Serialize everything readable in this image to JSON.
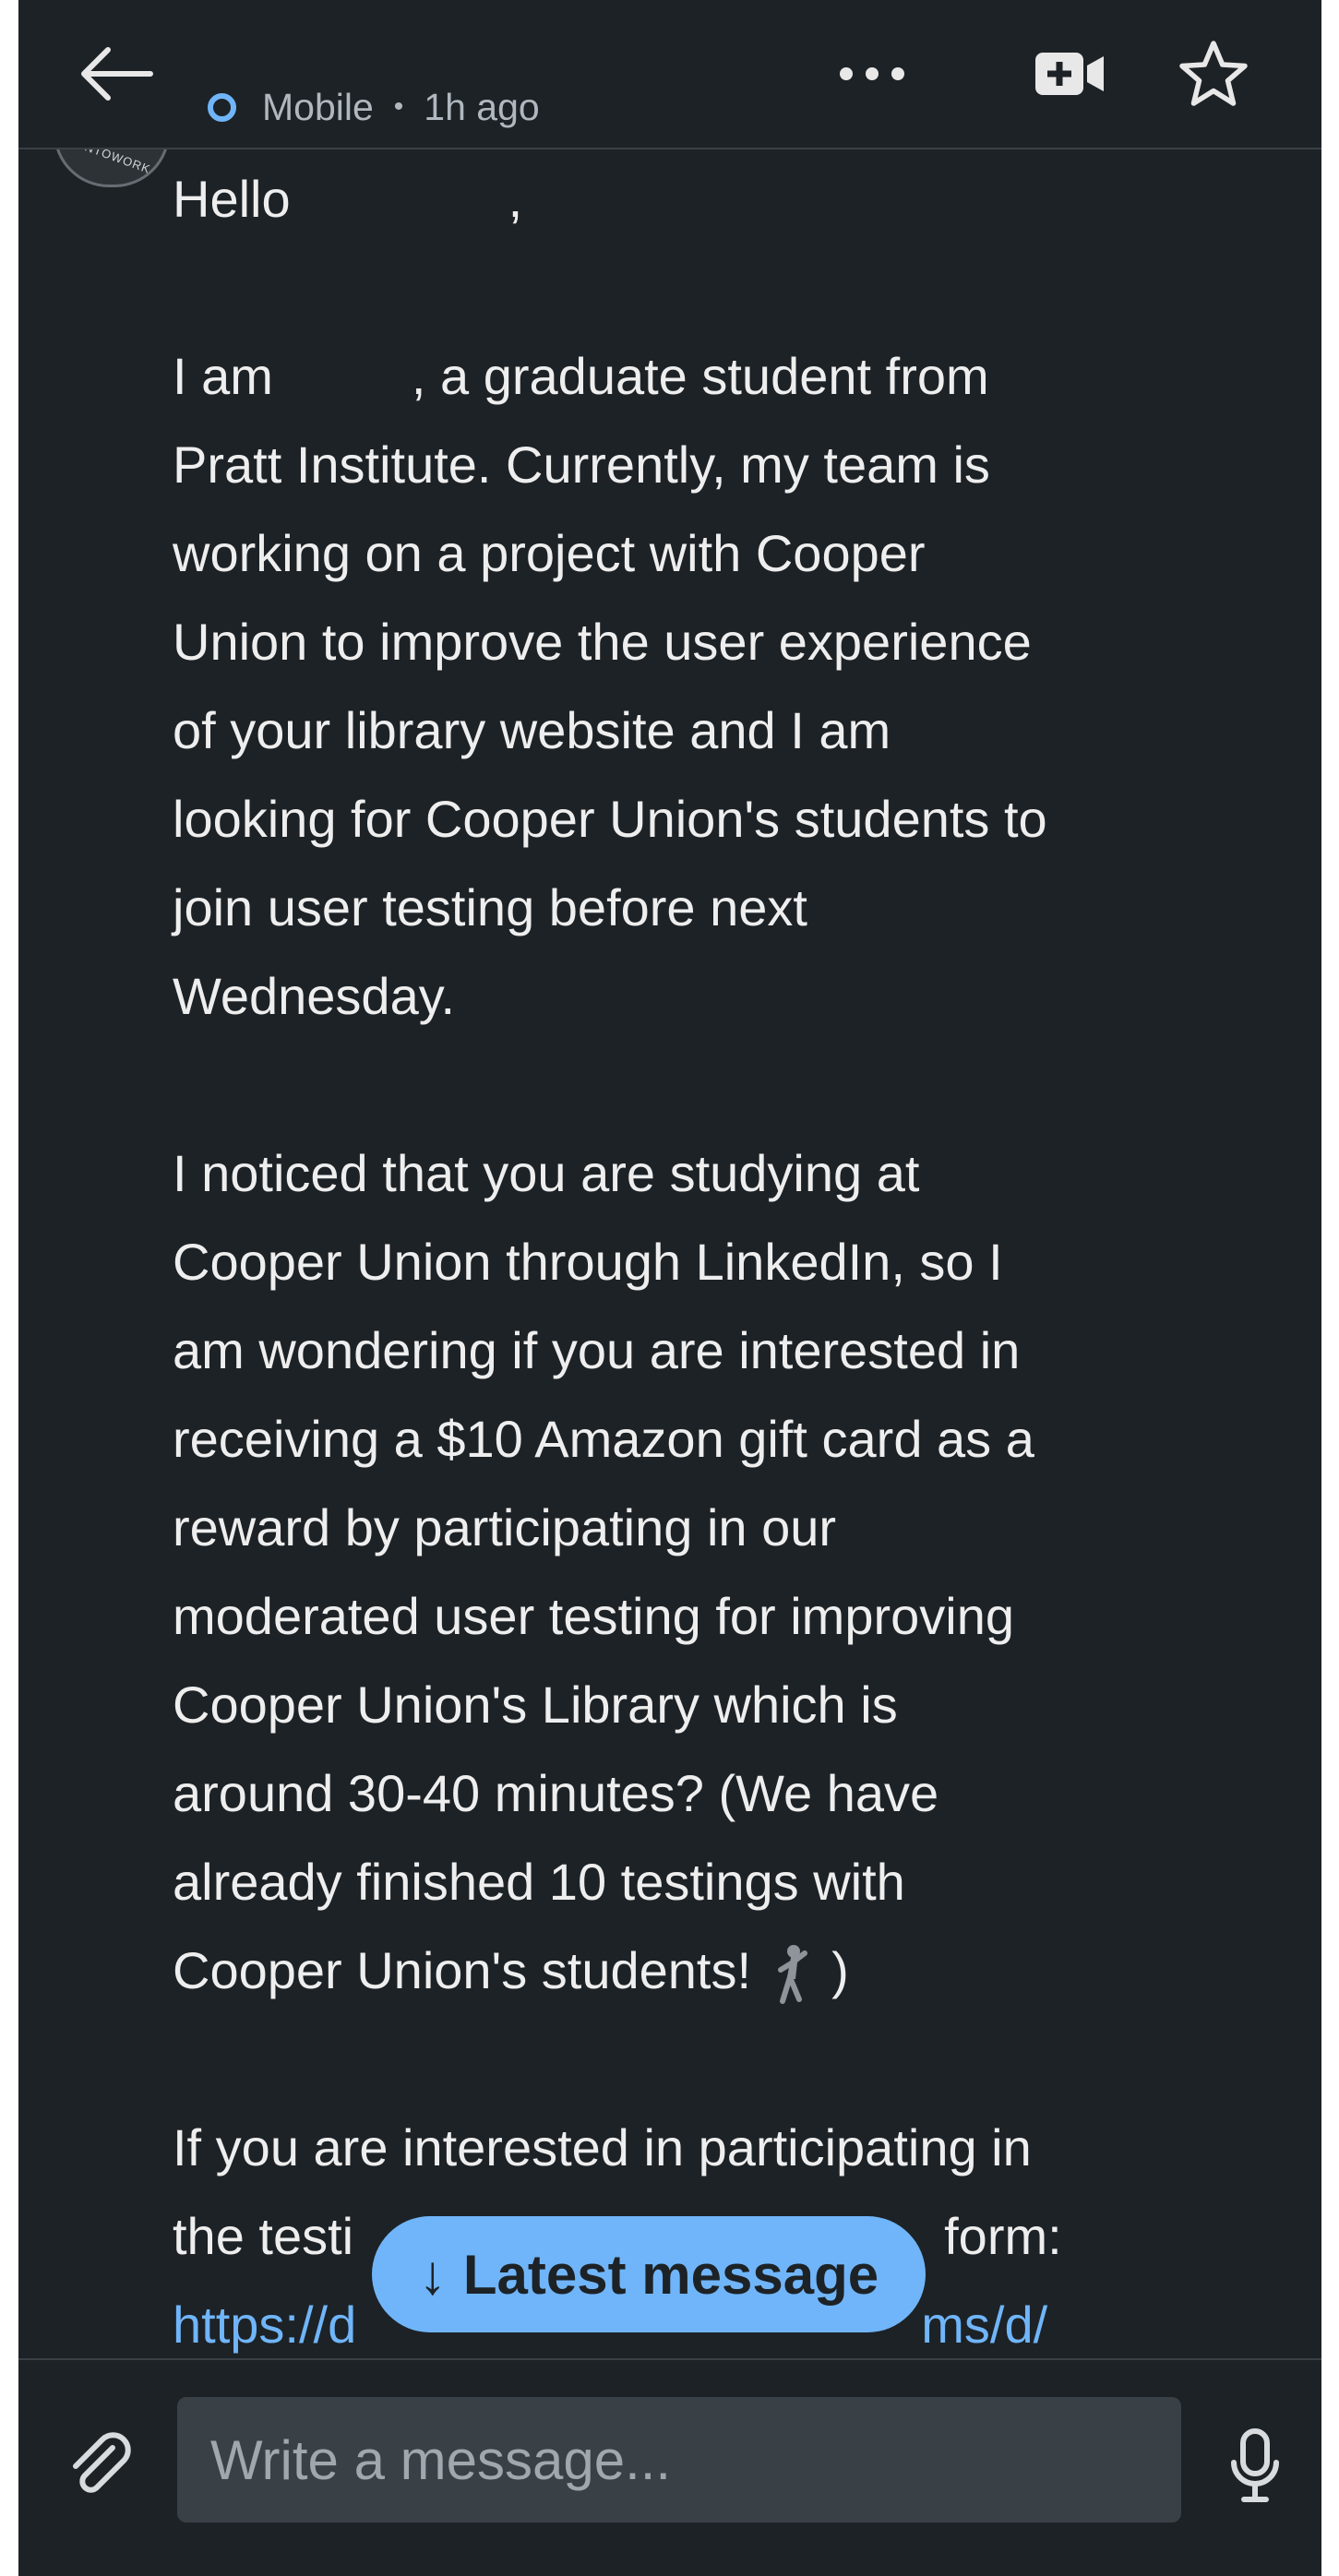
{
  "header": {
    "status_label": "Mobile",
    "separator": "•",
    "time_label": "1h ago",
    "avatar_text": "ENTOWORK"
  },
  "message": {
    "greeting_prefix": "Hello",
    "greeting_suffix": ",",
    "p1_prefix": "I am",
    "p1_line1_rest": ", a graduate student from",
    "p1_lines": [
      "Pratt Institute. Currently, my team is",
      "working on a project with Cooper",
      "Union to improve the user experience",
      "of your library website and I am",
      "looking for Cooper Union's students to",
      "join user testing before next",
      "Wednesday."
    ],
    "p2_lines": [
      "I noticed that you are studying at",
      "Cooper Union through LinkedIn, so I",
      "am wondering if you are interested in",
      "receiving a $10 Amazon gift card as a",
      "reward by participating in our",
      "moderated user testing for improving",
      "Cooper Union's Library which is",
      "around 30-40 minutes? (We have",
      "already finished 10 testings with"
    ],
    "p2_last_line_text": "Cooper Union's students!",
    "p2_last_line_end": ")",
    "p3_line1": "If you are interested in participating in",
    "p3_line2_start": "the testi",
    "p3_line2_end": "form:",
    "p3_link_start": "https://d",
    "p3_link_end": "ms/d/"
  },
  "latest_button": {
    "arrow": "↓",
    "label": "Latest message"
  },
  "composer": {
    "placeholder": "Write a message..."
  },
  "icons": {
    "back": "arrow-left-icon",
    "more": "more-horizontal-icon",
    "video": "video-add-icon",
    "star": "star-outline-icon",
    "attach": "paperclip-icon",
    "mic": "microphone-icon"
  },
  "colors": {
    "background": "#1d2226",
    "text": "#eeeeee",
    "link": "#70b5f9",
    "status_ring": "#70b5f9",
    "input_bg": "#3a4146",
    "pill": "#70b5f9"
  }
}
